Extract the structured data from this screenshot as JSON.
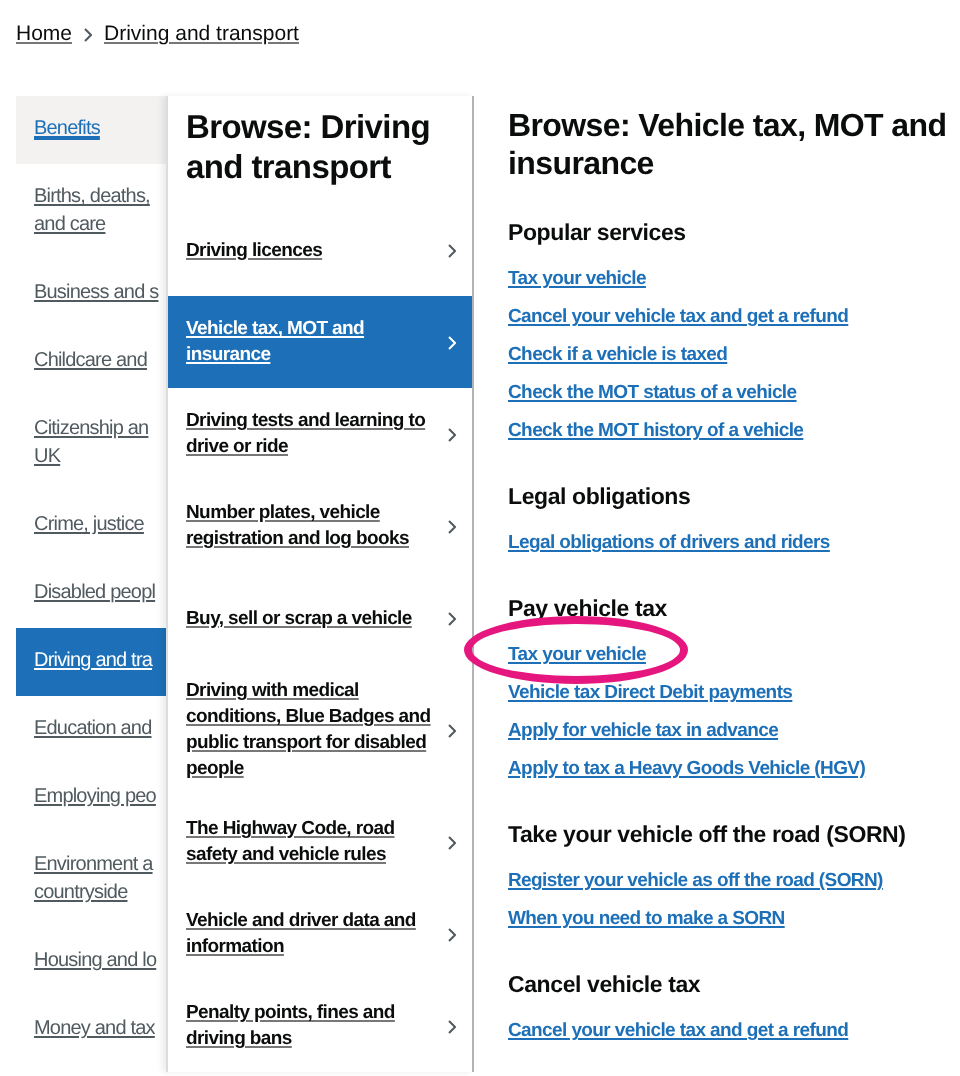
{
  "breadcrumbs": [
    {
      "label": "Home"
    },
    {
      "label": "Driving and transport"
    }
  ],
  "topics": [
    {
      "lines": [
        "Benefits"
      ],
      "selected": false,
      "hovered": true
    },
    {
      "lines": [
        "Births, deaths,",
        "and care"
      ],
      "selected": false,
      "hovered": false
    },
    {
      "lines": [
        "Business and s"
      ],
      "selected": false,
      "hovered": false
    },
    {
      "lines": [
        "Childcare and"
      ],
      "selected": false,
      "hovered": false
    },
    {
      "lines": [
        "Citizenship an",
        "UK"
      ],
      "selected": false,
      "hovered": false
    },
    {
      "lines": [
        "Crime, justice"
      ],
      "selected": false,
      "hovered": false
    },
    {
      "lines": [
        "Disabled peopl"
      ],
      "selected": false,
      "hovered": false
    },
    {
      "lines": [
        "Driving and tra"
      ],
      "selected": true,
      "hovered": false
    },
    {
      "lines": [
        "Education and"
      ],
      "selected": false,
      "hovered": false
    },
    {
      "lines": [
        "Employing peo"
      ],
      "selected": false,
      "hovered": false
    },
    {
      "lines": [
        "Environment a",
        "countryside"
      ],
      "selected": false,
      "hovered": false
    },
    {
      "lines": [
        "Housing and lo"
      ],
      "selected": false,
      "hovered": false
    },
    {
      "lines": [
        "Money and tax"
      ],
      "selected": false,
      "hovered": false
    }
  ],
  "subtopics": {
    "heading": "Browse: Driving and transport",
    "items": [
      {
        "label": "Driving licences",
        "selected": false
      },
      {
        "label": "Vehicle tax, MOT and insurance",
        "selected": true
      },
      {
        "label": "Driving tests and learning to drive or ride",
        "selected": false
      },
      {
        "label": "Number plates, vehicle registration and log books",
        "selected": false
      },
      {
        "label": "Buy, sell or scrap a vehicle",
        "selected": false
      },
      {
        "label": "Driving with medical conditions, Blue Badges and public transport for disabled people",
        "selected": false
      },
      {
        "label": "The Highway Code, road safety and vehicle rules",
        "selected": false
      },
      {
        "label": "Vehicle and driver data and information",
        "selected": false
      },
      {
        "label": "Penalty points, fines and driving bans",
        "selected": false
      }
    ]
  },
  "content": {
    "heading": "Browse: Vehicle tax, MOT and insurance",
    "sections": [
      {
        "heading": "Popular services",
        "links": [
          {
            "label": "Tax your vehicle",
            "circled": false
          },
          {
            "label": "Cancel your vehicle tax and get a refund",
            "circled": false
          },
          {
            "label": "Check if a vehicle is taxed",
            "circled": false
          },
          {
            "label": "Check the MOT status of a vehicle",
            "circled": false
          },
          {
            "label": "Check the MOT history of a vehicle",
            "circled": false
          }
        ]
      },
      {
        "heading": "Legal obligations",
        "links": [
          {
            "label": "Legal obligations of drivers and riders",
            "circled": false
          }
        ]
      },
      {
        "heading": "Pay vehicle tax",
        "links": [
          {
            "label": "Tax your vehicle",
            "circled": true
          },
          {
            "label": "Vehicle tax Direct Debit payments",
            "circled": false
          },
          {
            "label": "Apply for vehicle tax in advance",
            "circled": false
          },
          {
            "label": "Apply to tax a Heavy Goods Vehicle (HGV)",
            "circled": false
          }
        ]
      },
      {
        "heading": "Take your vehicle off the road (SORN)",
        "links": [
          {
            "label": "Register your vehicle as off the road (SORN)",
            "circled": false
          },
          {
            "label": "When you need to make a SORN",
            "circled": false
          }
        ]
      },
      {
        "heading": "Cancel vehicle tax",
        "links": [
          {
            "label": "Cancel your vehicle tax and get a refund",
            "circled": false
          }
        ]
      }
    ]
  }
}
